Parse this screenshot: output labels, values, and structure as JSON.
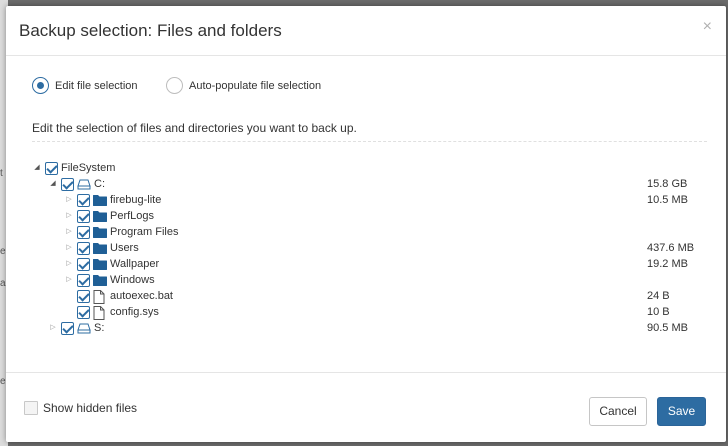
{
  "background": {
    "marks": [
      "t",
      "e",
      "a",
      "e"
    ]
  },
  "dialog": {
    "title": "Backup selection: Files and folders",
    "close_glyph": "×"
  },
  "mode": {
    "options": [
      {
        "label": "Edit file selection",
        "selected": true
      },
      {
        "label": "Auto-populate file selection",
        "selected": false
      }
    ]
  },
  "instructions": "Edit the selection of files and directories you want to back up.",
  "tree": {
    "nodes": [
      {
        "label": "FileSystem",
        "icon": "none",
        "expanded": true,
        "checked": true,
        "size": ""
      },
      {
        "label": "C:",
        "icon": "drive-icon",
        "expanded": true,
        "checked": true,
        "size": "15.8 GB"
      },
      {
        "label": "firebug-lite",
        "icon": "folder-icon",
        "expanded": false,
        "checked": true,
        "size": "10.5 MB"
      },
      {
        "label": "PerfLogs",
        "icon": "folder-icon",
        "expanded": false,
        "checked": true,
        "size": ""
      },
      {
        "label": "Program Files",
        "icon": "folder-icon",
        "expanded": false,
        "checked": true,
        "size": ""
      },
      {
        "label": "Users",
        "icon": "folder-icon",
        "expanded": false,
        "checked": true,
        "size": "437.6 MB"
      },
      {
        "label": "Wallpaper",
        "icon": "folder-icon",
        "expanded": false,
        "checked": true,
        "size": "19.2 MB"
      },
      {
        "label": "Windows",
        "icon": "folder-icon",
        "expanded": false,
        "checked": true,
        "size": ""
      },
      {
        "label": "autoexec.bat",
        "icon": "file-icon",
        "expanded": null,
        "checked": true,
        "size": "24 B"
      },
      {
        "label": "config.sys",
        "icon": "file-icon",
        "expanded": null,
        "checked": true,
        "size": "10 B"
      },
      {
        "label": "S:",
        "icon": "drive-icon",
        "expanded": false,
        "checked": true,
        "size": "90.5 MB"
      }
    ]
  },
  "footer": {
    "show_hidden_label": "Show hidden files",
    "show_hidden_checked": false,
    "cancel_label": "Cancel",
    "save_label": "Save"
  },
  "colors": {
    "accent": "#2d6ca2",
    "overlay": "#6b6b6b"
  }
}
